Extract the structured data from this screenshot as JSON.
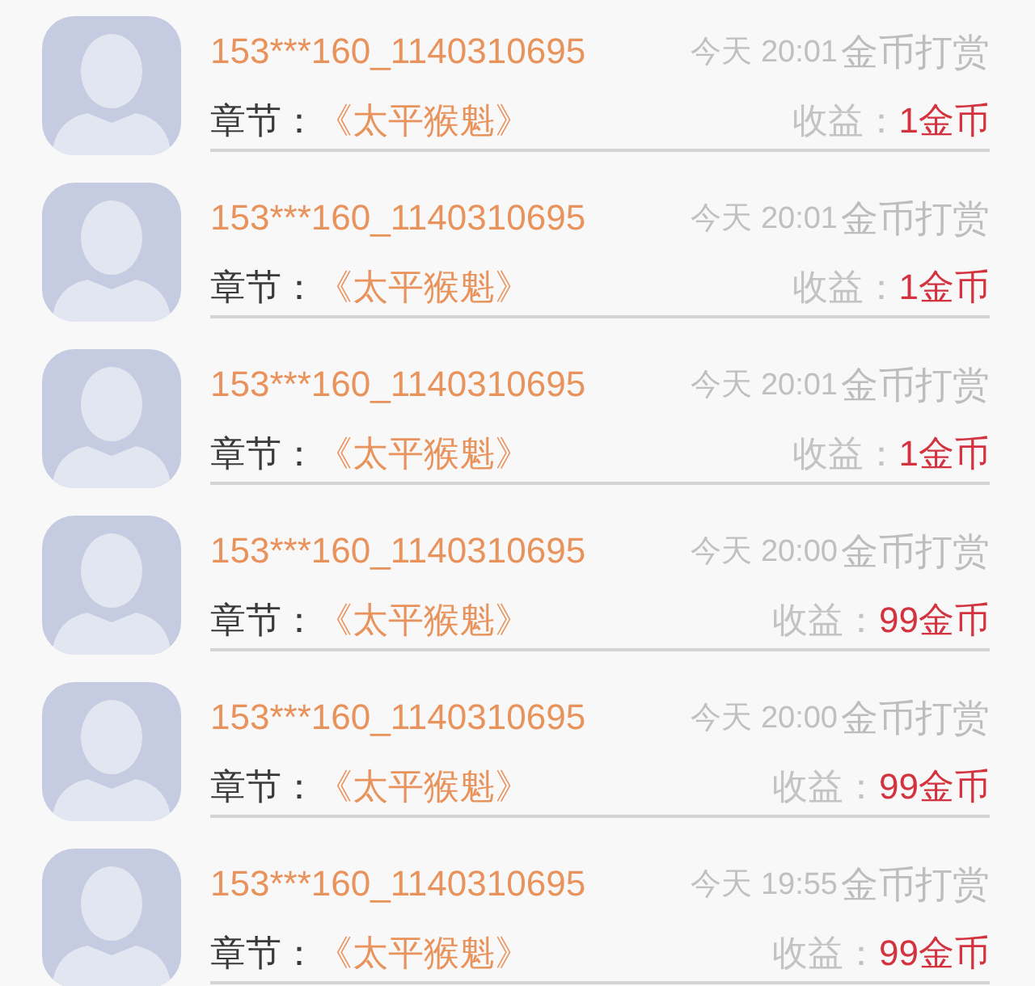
{
  "rewards": [
    {
      "user": "153***160_1140310695",
      "time": "今天 20:01",
      "type": "金币打赏",
      "chapter_label": "章节：",
      "chapter": "《太平猴魁》",
      "income_label": "收益：",
      "amount": "1金币"
    },
    {
      "user": "153***160_1140310695",
      "time": "今天 20:01",
      "type": "金币打赏",
      "chapter_label": "章节：",
      "chapter": "《太平猴魁》",
      "income_label": "收益：",
      "amount": "1金币"
    },
    {
      "user": "153***160_1140310695",
      "time": "今天 20:01",
      "type": "金币打赏",
      "chapter_label": "章节：",
      "chapter": "《太平猴魁》",
      "income_label": "收益：",
      "amount": "1金币"
    },
    {
      "user": "153***160_1140310695",
      "time": "今天 20:00",
      "type": "金币打赏",
      "chapter_label": "章节：",
      "chapter": "《太平猴魁》",
      "income_label": "收益：",
      "amount": "99金币"
    },
    {
      "user": "153***160_1140310695",
      "time": "今天 20:00",
      "type": "金币打赏",
      "chapter_label": "章节：",
      "chapter": "《太平猴魁》",
      "income_label": "收益：",
      "amount": "99金币"
    },
    {
      "user": "153***160_1140310695",
      "time": "今天 19:55",
      "type": "金币打赏",
      "chapter_label": "章节：",
      "chapter": "《太平猴魁》",
      "income_label": "收益：",
      "amount": "99金币"
    }
  ]
}
